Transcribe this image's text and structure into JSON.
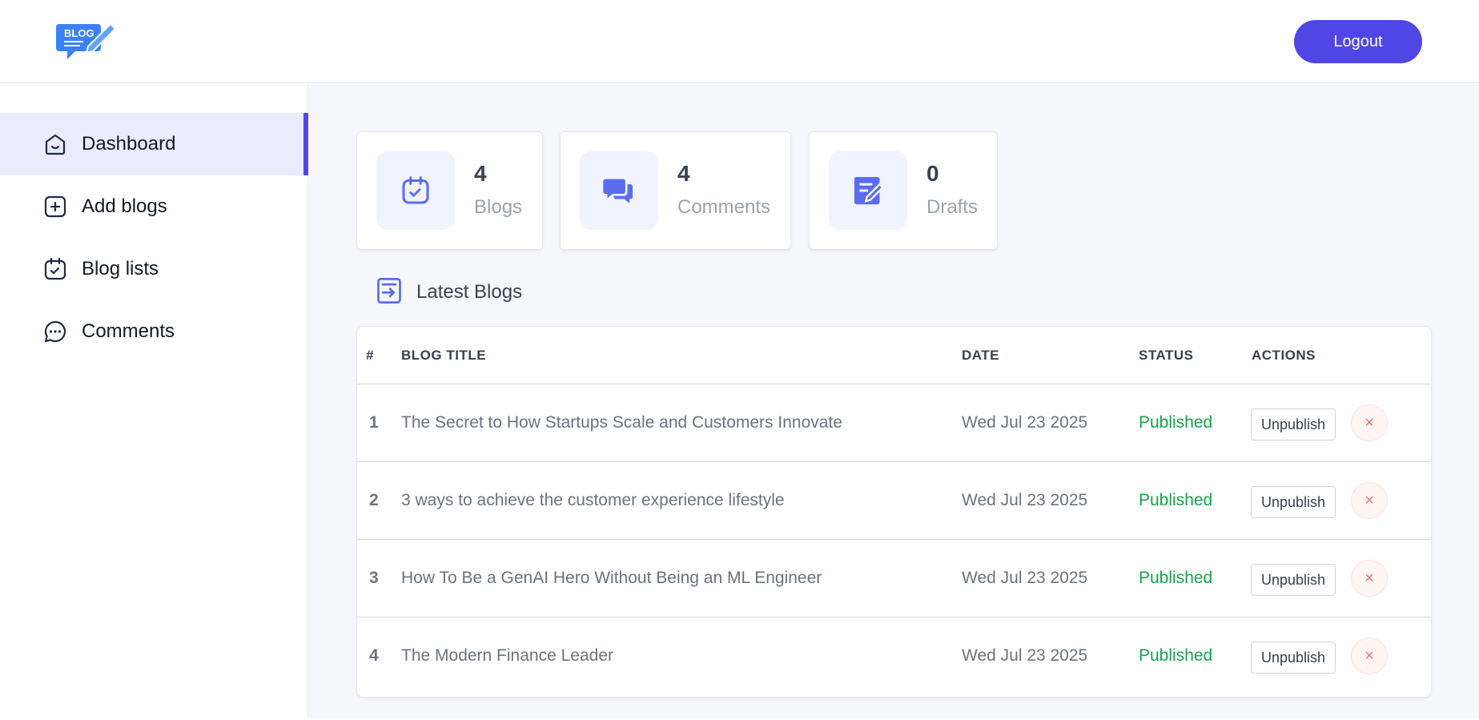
{
  "header": {
    "logo_text": "BLOG",
    "logout_label": "Logout"
  },
  "sidebar": {
    "items": [
      {
        "label": "Dashboard",
        "icon": "home-icon",
        "active": true
      },
      {
        "label": "Add blogs",
        "icon": "add-square-icon",
        "active": false
      },
      {
        "label": "Blog lists",
        "icon": "calendar-check-icon",
        "active": false
      },
      {
        "label": "Comments",
        "icon": "chat-bubble-icon",
        "active": false
      }
    ]
  },
  "stats": [
    {
      "value": "4",
      "label": "Blogs",
      "icon": "calendar-check-icon"
    },
    {
      "value": "4",
      "label": "Comments",
      "icon": "chat-bubbles-icon"
    },
    {
      "value": "0",
      "label": "Drafts",
      "icon": "edit-note-icon"
    }
  ],
  "latest": {
    "title": "Latest Blogs",
    "icon": "document-arrow-icon"
  },
  "table": {
    "headers": {
      "num": "#",
      "title": "BLOG TITLE",
      "date": "DATE",
      "status": "STATUS",
      "actions": "ACTIONS"
    },
    "rows": [
      {
        "num": "1",
        "title": "The Secret to How Startups Scale and Customers Innovate",
        "date": "Wed Jul 23 2025",
        "status": "Published",
        "action": "Unpublish",
        "delete": "×"
      },
      {
        "num": "2",
        "title": "3 ways to achieve the customer experience lifestyle",
        "date": "Wed Jul 23 2025",
        "status": "Published",
        "action": "Unpublish",
        "delete": "×"
      },
      {
        "num": "3",
        "title": "How To Be a GenAI Hero Without Being an ML Engineer",
        "date": "Wed Jul 23 2025",
        "status": "Published",
        "action": "Unpublish",
        "delete": "×"
      },
      {
        "num": "4",
        "title": "The Modern Finance Leader",
        "date": "Wed Jul 23 2025",
        "status": "Published",
        "action": "Unpublish",
        "delete": "×"
      }
    ]
  },
  "colors": {
    "accent": "#4f46e5",
    "published": "#16a34a",
    "active_nav_bg": "#ecebfd",
    "stat_icon": "#5b6cf0"
  }
}
